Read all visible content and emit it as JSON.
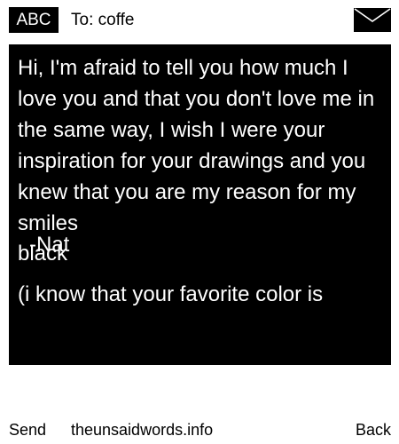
{
  "header": {
    "mode_label": "ABC",
    "recipient": "To: coffe",
    "icon": "envelope-icon"
  },
  "message": {
    "body": "Hi, I'm afraid to tell you how much I love you and that you don't love me in the same way, I wish I were your inspiration for your drawings and you knew that you are my reason for my smiles",
    "signature_name": "-Nat",
    "signature_color": "black",
    "hint": "(i know that your favorite color is"
  },
  "footer": {
    "left_softkey": "Send",
    "site": "theunsaidwords.info",
    "right_softkey": "Back"
  },
  "colors": {
    "background": "#ffffff",
    "message_background": "#000000",
    "message_text": "#ffffff"
  }
}
